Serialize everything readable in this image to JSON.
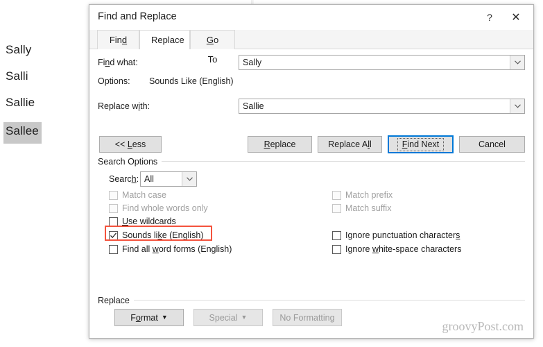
{
  "document": {
    "lines": [
      {
        "text": "Sally",
        "selected": false
      },
      {
        "text": "Salli",
        "selected": false
      },
      {
        "text": "Sallie",
        "selected": false
      },
      {
        "text": "Sallee",
        "selected": true
      }
    ]
  },
  "dialog": {
    "title": "Find and Replace",
    "help_label": "?",
    "close_label": "✕",
    "tabs": [
      {
        "label": "Find",
        "active": false
      },
      {
        "label": "Replace",
        "active": true
      },
      {
        "label": "Go To",
        "active": false
      }
    ],
    "find_what": {
      "label": "Find what:",
      "value": "Sally"
    },
    "options": {
      "label": "Options:",
      "value": "Sounds Like (English)"
    },
    "replace_with": {
      "label": "Replace with:",
      "value": "Sallie"
    },
    "buttons": {
      "less": "<< Less",
      "replace": "Replace",
      "replace_all": "Replace All",
      "find_next": "Find Next",
      "cancel": "Cancel"
    },
    "search_options": {
      "group_label": "Search Options",
      "search_label": "Search:",
      "search_value": "All",
      "checkboxes_left": [
        {
          "label": "Match case",
          "checked": false,
          "disabled": true
        },
        {
          "label": "Find whole words only",
          "checked": false,
          "disabled": true
        },
        {
          "label": "Use wildcards",
          "checked": false,
          "disabled": false
        },
        {
          "label": "Sounds like (English)",
          "checked": true,
          "disabled": false
        },
        {
          "label": "Find all word forms (English)",
          "checked": false,
          "disabled": false
        }
      ],
      "checkboxes_right": [
        {
          "label": "Match prefix",
          "checked": false,
          "disabled": true
        },
        {
          "label": "Match suffix",
          "checked": false,
          "disabled": true
        },
        {
          "label": "Ignore punctuation characters",
          "checked": false,
          "disabled": false
        },
        {
          "label": "Ignore white-space characters",
          "checked": false,
          "disabled": false
        }
      ],
      "highlight_color": "#f4533d"
    },
    "replace_group": {
      "group_label": "Replace",
      "format_button": "Format",
      "special_button": "Special",
      "no_formatting_button": "No Formatting"
    }
  },
  "watermark": "groovyPost.com",
  "colors": {
    "accent": "#0078d7",
    "annotation": "#f4533d",
    "selection": "#c8c8c8"
  }
}
